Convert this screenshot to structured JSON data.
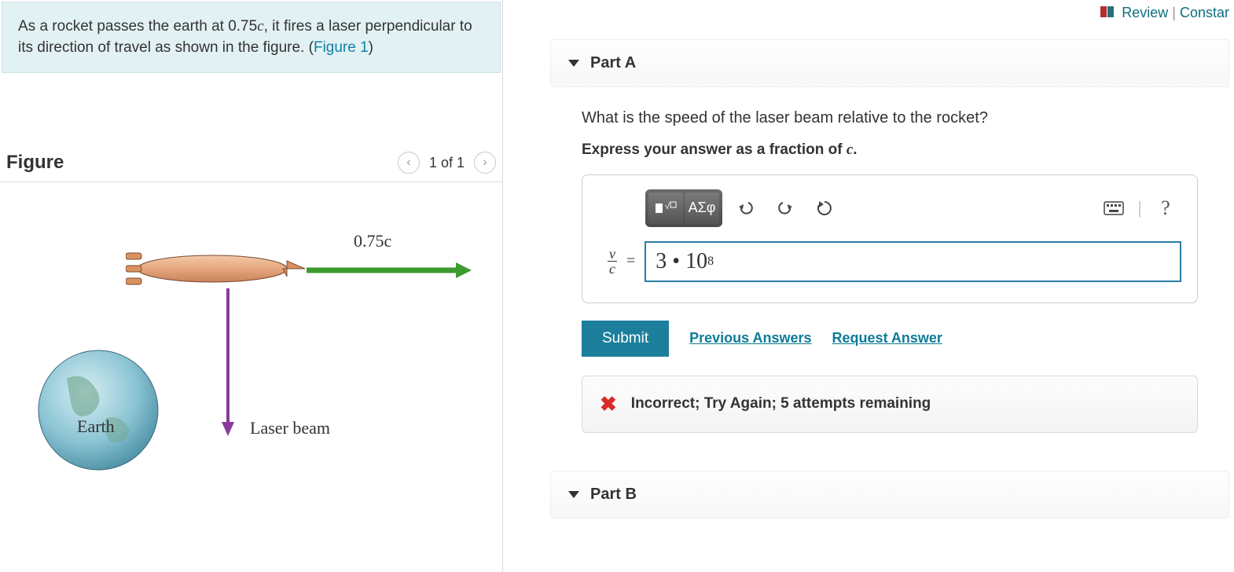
{
  "topLinks": {
    "review": "Review",
    "constants": "Constar"
  },
  "problem": {
    "textBefore": "As a rocket passes the earth at 0.75",
    "textAfter": ", it fires a laser perpendicular to its direction of travel as shown in the figure. (",
    "figureLink": "Figure 1",
    "textEnd": ")"
  },
  "figure": {
    "heading": "Figure",
    "pageIndicator": "1 of 1",
    "velocityLabel": "0.75c",
    "laserLabel": "Laser beam",
    "earthLabel": "Earth"
  },
  "partA": {
    "title": "Part A",
    "question": "What is the speed of the laser beam relative to the rocket?",
    "instruction_prefix": "Express your answer as a fraction of ",
    "instruction_var": "c",
    "instruction_suffix": ".",
    "fracNum": "v",
    "fracDen": "c",
    "answerDisplay": "3 • 10",
    "answerExp": "8",
    "submit": "Submit",
    "prevAnswers": "Previous Answers",
    "requestAnswer": "Request Answer",
    "feedback": "Incorrect; Try Again; 5 attempts remaining"
  },
  "partB": {
    "title": "Part B"
  },
  "toolbar": {
    "greek": "ΑΣφ",
    "help": "?"
  }
}
